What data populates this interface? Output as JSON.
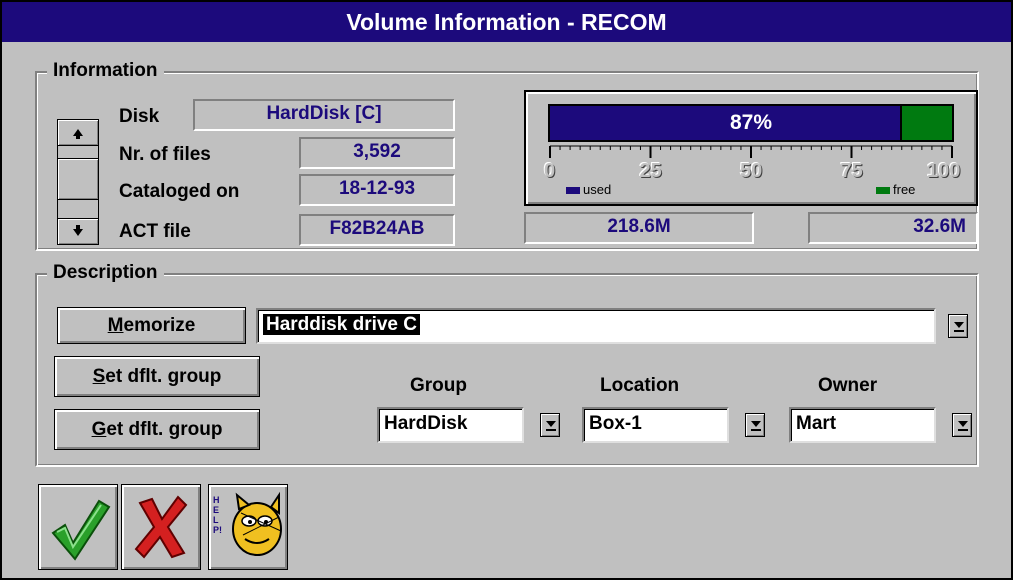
{
  "window": {
    "title": "Volume Information - RECOM"
  },
  "info": {
    "section_label": "Information",
    "disk_label": "Disk",
    "disk_value": "HardDisk  [C]",
    "files_label": "Nr. of files",
    "files_value": "3,592",
    "cataloged_label": "Cataloged on",
    "cataloged_value": "18-12-93",
    "act_label": "ACT file",
    "act_value": "F82B24AB"
  },
  "usage": {
    "used_percent": 87,
    "percent_label": "87%",
    "ticks": [
      "0",
      "25",
      "50",
      "75",
      "100"
    ],
    "used_legend": "used",
    "free_legend": "free",
    "used_size": "218.6M",
    "free_size": "32.6M",
    "colors": {
      "used": "#1c0a7c",
      "free": "#007a10"
    }
  },
  "description": {
    "section_label": "Description",
    "memorize_button": "Memorize",
    "memorize_hotkey": "M",
    "memorize_rest": "emorize",
    "set_default_hotkey": "S",
    "set_default_rest": "et dflt. group",
    "get_default_hotkey": "G",
    "get_default_rest": "et dflt. group",
    "description_value": "Harddisk drive C",
    "group_label": "Group",
    "group_value": "HardDisk",
    "location_label": "Location",
    "location_value": "Box-1",
    "owner_label": "Owner",
    "owner_value": "Mart"
  },
  "toolbar": {
    "help_label": "HELP!",
    "icons": [
      "ok-checkmark-icon",
      "cancel-x-icon",
      "help-garfield-icon"
    ]
  }
}
